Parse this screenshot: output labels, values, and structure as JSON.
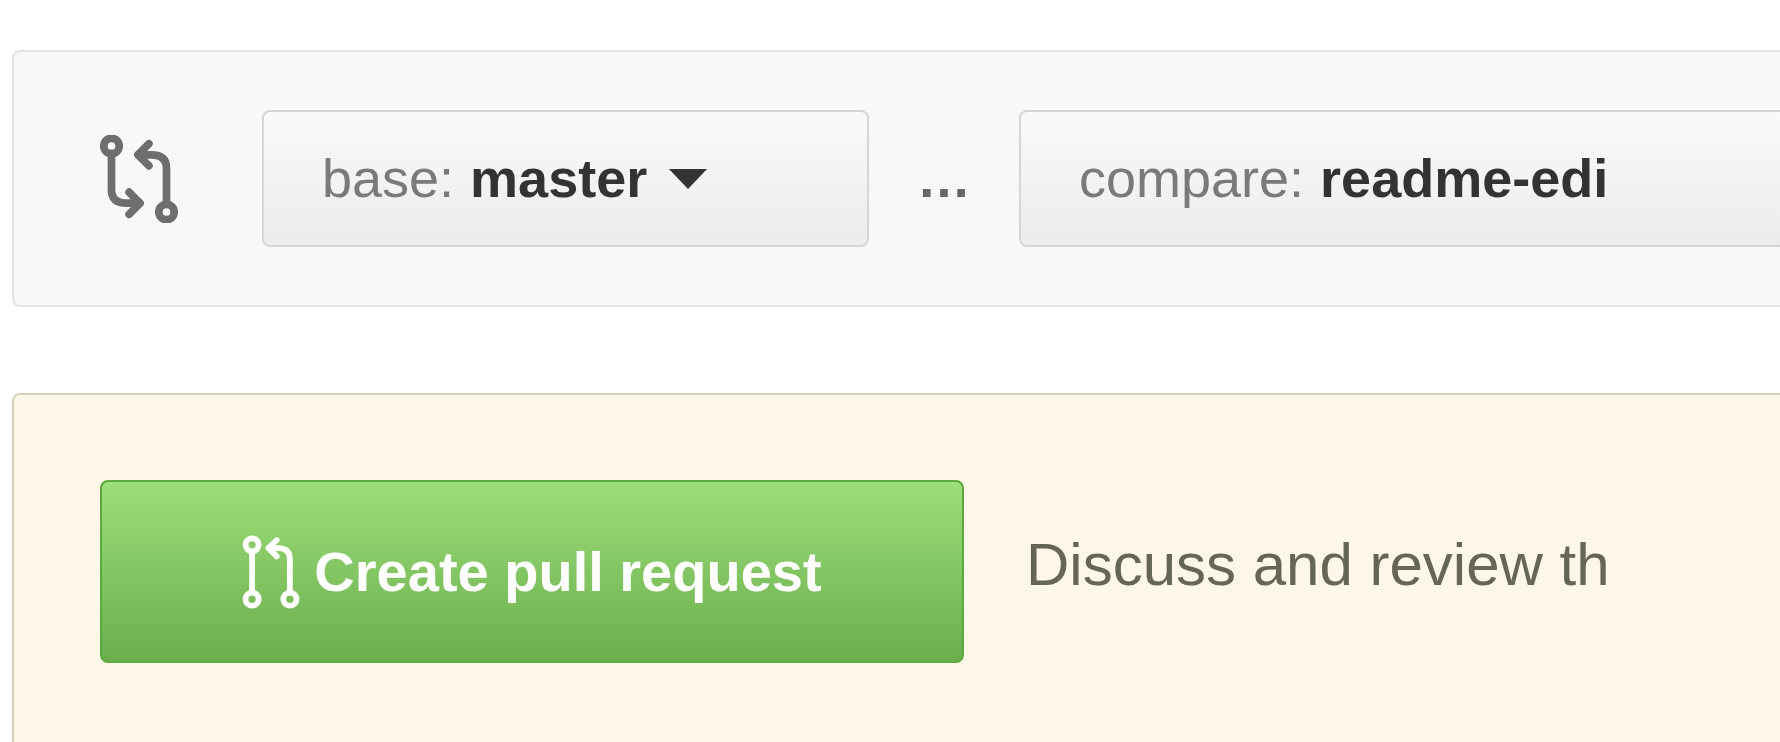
{
  "compare_bar": {
    "base_button": {
      "label": "base:",
      "branch": "master"
    },
    "separator": "…",
    "compare_button": {
      "label": "compare:",
      "branch": "readme-edi"
    }
  },
  "create_panel": {
    "button": "Create pull request",
    "description": "Discuss and review th"
  }
}
